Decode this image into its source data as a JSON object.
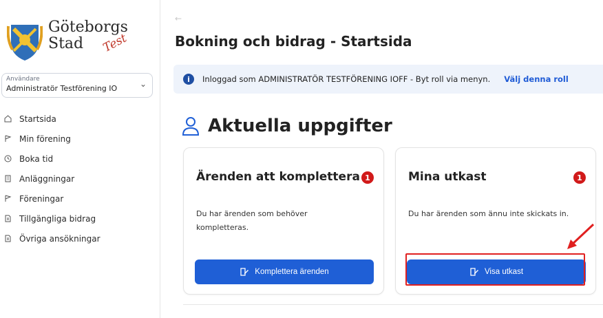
{
  "logo": {
    "line1": "Göteborgs",
    "line2": "Stad",
    "badge": "Test"
  },
  "role": {
    "label": "Användare",
    "value": "Administratör Testförening IO"
  },
  "sidebar": {
    "items": [
      {
        "label": "Startsida",
        "icon": "home-icon"
      },
      {
        "label": "Min förening",
        "icon": "flag-icon"
      },
      {
        "label": "Boka tid",
        "icon": "clock-icon"
      },
      {
        "label": "Anläggningar",
        "icon": "building-icon"
      },
      {
        "label": "Föreningar",
        "icon": "flag-icon"
      },
      {
        "label": "Tillgängliga bidrag",
        "icon": "document-icon"
      },
      {
        "label": "Övriga ansökningar",
        "icon": "document-icon"
      }
    ]
  },
  "page": {
    "back": "←",
    "title": "Bokning och bidrag - Startsida"
  },
  "banner": {
    "text": "Inloggad som ADMINISTRATÖR TESTFÖRENING IOFF - Byt roll via menyn.",
    "link": "Välj denna roll"
  },
  "section": {
    "title": "Aktuella uppgifter"
  },
  "cards": [
    {
      "title": "Ärenden att komplettera",
      "badge": "1",
      "desc": "Du har ärenden som behöver kompletteras.",
      "button": "Komplettera ärenden"
    },
    {
      "title": "Mina utkast",
      "badge": "1",
      "desc": "Du har ärenden som ännu inte skickats in.",
      "button": "Visa utkast"
    }
  ],
  "colors": {
    "primary": "#1f5fd6",
    "badge": "#d11a1a",
    "banner_bg": "#eef3fb",
    "annotation": "#e02020"
  }
}
